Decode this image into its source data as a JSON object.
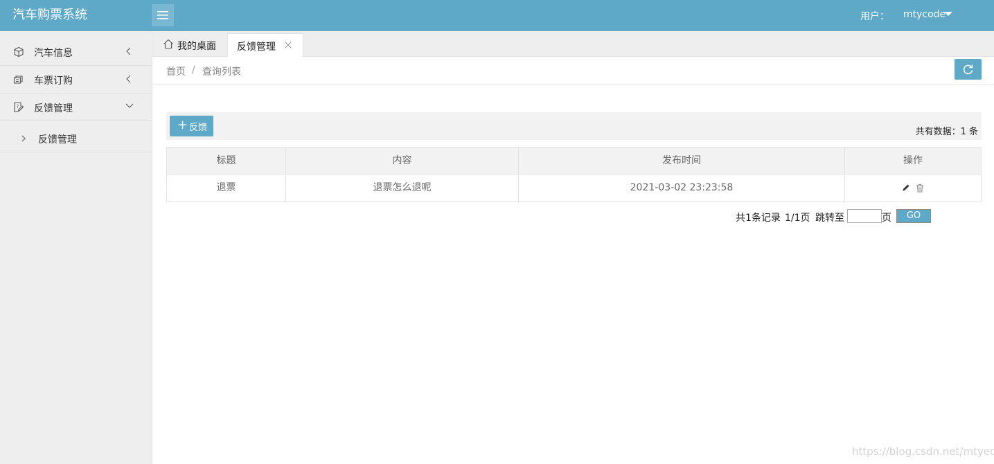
{
  "app": {
    "title": "汽车购票系统"
  },
  "header": {
    "user_label": "用户：",
    "user_name": "mtycode"
  },
  "sidebar": {
    "items": [
      {
        "label": "汽车信息",
        "icon": "cube-icon",
        "expanded": false
      },
      {
        "label": "车票订购",
        "icon": "ticket-icon",
        "expanded": false
      },
      {
        "label": "反馈管理",
        "icon": "edit-document-icon",
        "expanded": true
      }
    ],
    "sub_items": [
      {
        "label": "反馈管理"
      }
    ]
  },
  "tabs": [
    {
      "label": "我的桌面",
      "icon": "home-icon",
      "active": false
    },
    {
      "label": "反馈管理",
      "active": true,
      "closable": true
    }
  ],
  "breadcrumb": {
    "home": "首页",
    "separator": "/",
    "current": "查询列表"
  },
  "toolbar": {
    "add_label": "反馈",
    "total_text": "共有数据：1 条"
  },
  "table": {
    "columns": [
      "标题",
      "内容",
      "发布时间",
      "操作"
    ],
    "rows": [
      {
        "title": "退票",
        "content": "退票怎么退呢",
        "time": "2021-03-02 23:23:58"
      }
    ]
  },
  "pagination": {
    "total_text": "共1条记录",
    "pages_text": "1/1页",
    "jump_label": "跳转至",
    "page_unit": "页",
    "go_label": "GO",
    "input_value": ""
  },
  "watermark": "https://blog.csdn.net/mtyedu",
  "colors": {
    "primary": "#5fa9c8",
    "sidebar_bg": "#eeeeee"
  }
}
